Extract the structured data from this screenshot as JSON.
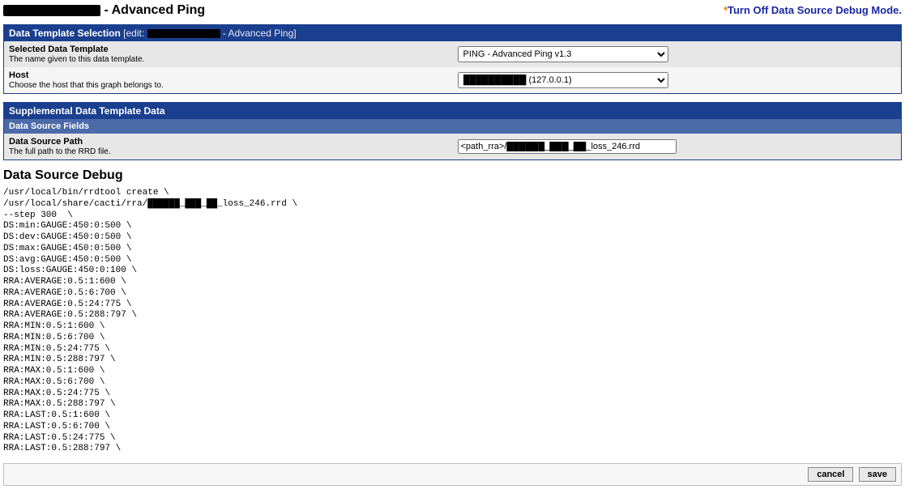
{
  "header": {
    "title_suffix": " - Advanced Ping",
    "debug_link": "Turn Off Data Source Debug Mode."
  },
  "template_selection": {
    "heading": "Data Template Selection",
    "heading_sub_prefix": " [edit: ",
    "heading_sub_suffix": " - Advanced Ping]",
    "rows": {
      "template": {
        "label": "Selected Data Template",
        "help": "The name given to this data template.",
        "value": "PING - Advanced Ping v1.3"
      },
      "host": {
        "label": "Host",
        "help": "Choose the host that this graph belongs to.",
        "value_suffix": " (127.0.0.1)"
      }
    }
  },
  "supplemental": {
    "heading": "Supplemental Data Template Data",
    "sub_heading": "Data Source Fields",
    "rows": {
      "path": {
        "label": "Data Source Path",
        "help": "The full path to the RRD file.",
        "value": "<path_rra>/██████_███_██_loss_246.rrd"
      }
    }
  },
  "debug": {
    "title": "Data Source Debug",
    "text": "/usr/local/bin/rrdtool create \\\n/usr/local/share/cacti/rra/██████_███_██_loss_246.rrd \\\n--step 300  \\\nDS:min:GAUGE:450:0:500 \\\nDS:dev:GAUGE:450:0:500 \\\nDS:max:GAUGE:450:0:500 \\\nDS:avg:GAUGE:450:0:500 \\\nDS:loss:GAUGE:450:0:100 \\\nRRA:AVERAGE:0.5:1:600 \\\nRRA:AVERAGE:0.5:6:700 \\\nRRA:AVERAGE:0.5:24:775 \\\nRRA:AVERAGE:0.5:288:797 \\\nRRA:MIN:0.5:1:600 \\\nRRA:MIN:0.5:6:700 \\\nRRA:MIN:0.5:24:775 \\\nRRA:MIN:0.5:288:797 \\\nRRA:MAX:0.5:1:600 \\\nRRA:MAX:0.5:6:700 \\\nRRA:MAX:0.5:24:775 \\\nRRA:MAX:0.5:288:797 \\\nRRA:LAST:0.5:1:600 \\\nRRA:LAST:0.5:6:700 \\\nRRA:LAST:0.5:24:775 \\\nRRA:LAST:0.5:288:797 \\"
  },
  "buttons": {
    "cancel": "cancel",
    "save": "save"
  }
}
